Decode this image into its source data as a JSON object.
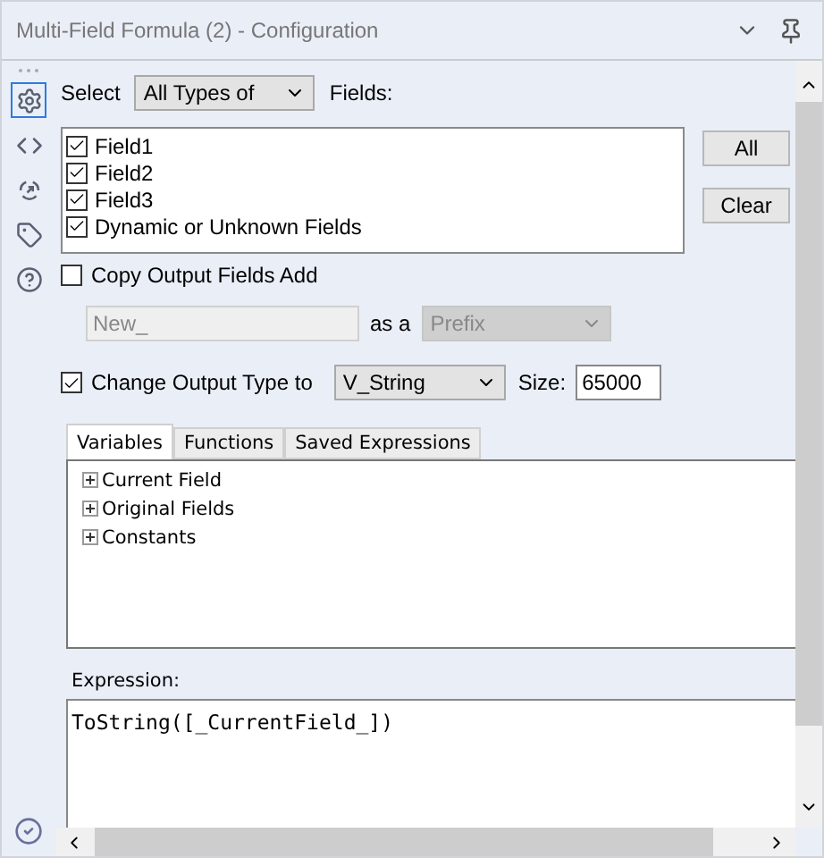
{
  "window": {
    "title": "Multi-Field Formula (2) - Configuration"
  },
  "sidebar": {
    "items": [
      {
        "kind": "settings",
        "selected": true
      },
      {
        "kind": "code",
        "selected": false
      },
      {
        "kind": "arrow",
        "selected": false
      },
      {
        "kind": "tag",
        "selected": false
      },
      {
        "kind": "help",
        "selected": false
      }
    ]
  },
  "select_row": {
    "label": "Select",
    "dropdown": "All Types of",
    "suffix": "Fields:"
  },
  "fields": [
    {
      "label": "Field1",
      "checked": true
    },
    {
      "label": "Field2",
      "checked": true
    },
    {
      "label": "Field3",
      "checked": true
    },
    {
      "label": "Dynamic or Unknown Fields",
      "checked": true
    }
  ],
  "buttons": [
    "All",
    "Clear"
  ],
  "copy_output": {
    "label": "Copy Output Fields Add",
    "checked": false,
    "value": "New_",
    "as_label": "as a",
    "position": "Prefix"
  },
  "change_output": {
    "label": "Change Output Type to",
    "checked": true,
    "type": "V_String",
    "size_label": "Size:",
    "size": "65000"
  },
  "tabs": [
    {
      "label": "Variables",
      "selected": true
    },
    {
      "label": "Functions",
      "selected": false
    },
    {
      "label": "Saved Expressions",
      "selected": false
    }
  ],
  "tree": [
    {
      "label": "Current Field",
      "expanded": false
    },
    {
      "label": "Original Fields",
      "expanded": false
    },
    {
      "label": "Constants",
      "expanded": false
    }
  ],
  "expression": {
    "label": "Expression:",
    "value": "ToString([_CurrentField_])"
  }
}
